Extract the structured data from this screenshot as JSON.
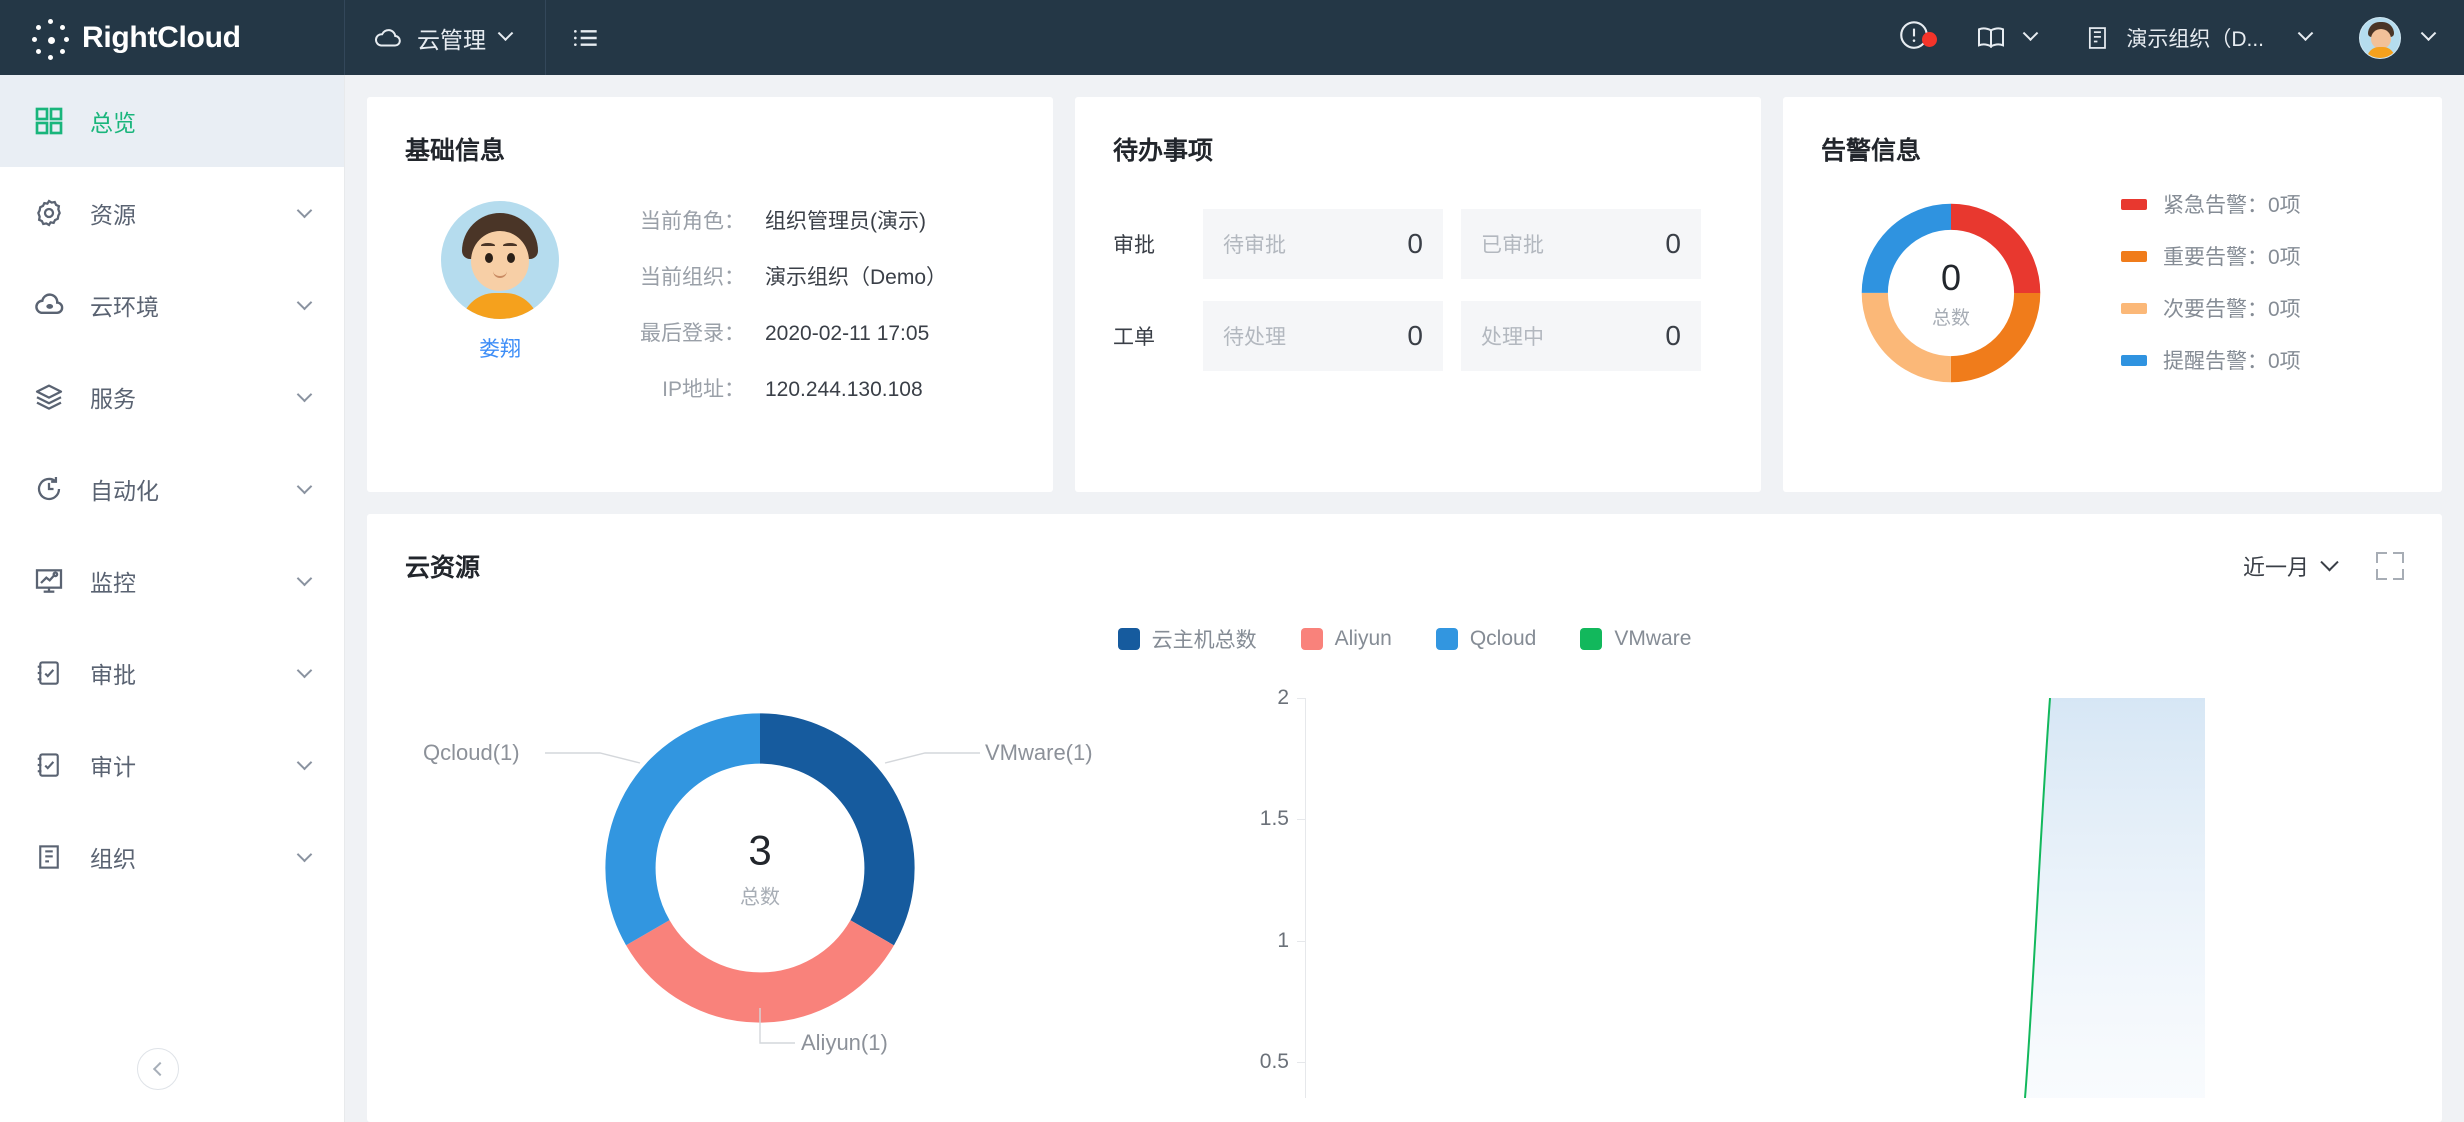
{
  "brand": {
    "name": "RightCloud",
    "logo_icon": "dots-logo-icon"
  },
  "header": {
    "cloud_mgmt": {
      "label": "云管理",
      "icon": "cloud-icon",
      "chevron": "chevron-down-icon"
    },
    "menu_icon": "list-menu-icon",
    "alert_icon": "alert-circle-icon",
    "book_icon": "book-icon",
    "book_chevron": "chevron-down-icon",
    "org": {
      "icon": "building-icon",
      "label": "演示组织（D...",
      "chevron": "chevron-down-icon"
    },
    "avatar": {
      "icon": "avatar-icon",
      "chevron": "chevron-down-icon"
    }
  },
  "sidebar": {
    "items": [
      {
        "label": "总览",
        "icon": "grid-icon",
        "active": true,
        "has_chevron": false
      },
      {
        "label": "资源",
        "icon": "gear-icon",
        "active": false,
        "has_chevron": true
      },
      {
        "label": "云环境",
        "icon": "cloud-icon",
        "active": false,
        "has_chevron": true
      },
      {
        "label": "服务",
        "icon": "layers-icon",
        "active": false,
        "has_chevron": true
      },
      {
        "label": "自动化",
        "icon": "clock-sync-icon",
        "active": false,
        "has_chevron": true
      },
      {
        "label": "监控",
        "icon": "monitor-icon",
        "active": false,
        "has_chevron": true
      },
      {
        "label": "审批",
        "icon": "approval-icon",
        "active": false,
        "has_chevron": true
      },
      {
        "label": "审计",
        "icon": "audit-icon",
        "active": false,
        "has_chevron": true
      },
      {
        "label": "组织",
        "icon": "org-icon",
        "active": false,
        "has_chevron": true
      }
    ],
    "collapse_icon": "chevron-left-icon"
  },
  "basic_info": {
    "title": "基础信息",
    "user_name": "娄翔",
    "rows": [
      {
        "label": "当前角色：",
        "value": "组织管理员(演示)"
      },
      {
        "label": "当前组织：",
        "value": "演示组织（Demo）"
      },
      {
        "label": "最后登录：",
        "value": "2020-02-11 17:05"
      },
      {
        "label": "IP地址：",
        "value": "120.244.130.108"
      }
    ]
  },
  "todo": {
    "title": "待办事项",
    "rows": [
      {
        "label": "审批",
        "boxes": [
          {
            "key": "待审批",
            "value": "0"
          },
          {
            "key": "已审批",
            "value": "0"
          }
        ]
      },
      {
        "label": "工单",
        "boxes": [
          {
            "key": "待处理",
            "value": "0"
          },
          {
            "key": "处理中",
            "value": "0"
          }
        ]
      }
    ]
  },
  "alerts": {
    "title": "告警信息",
    "total": "0",
    "total_caption": "总数",
    "legend": [
      {
        "label": "紧急告警：0项",
        "color": "#e8382f"
      },
      {
        "label": "重要告警：0项",
        "color": "#f07c1b"
      },
      {
        "label": "次要告警：0项",
        "color": "#fbb878"
      },
      {
        "label": "提醒告警：0项",
        "color": "#2f93e0"
      }
    ],
    "chart_data": {
      "type": "pie",
      "title": "告警信息",
      "labels": [
        "紧急告警",
        "重要告警",
        "次要告警",
        "提醒告警"
      ],
      "values": [
        1,
        1,
        1,
        1
      ],
      "displayed_counts": [
        0,
        0,
        0,
        0
      ],
      "colors": [
        "#e8382f",
        "#f07c1b",
        "#fbb878",
        "#2f93e0"
      ],
      "center_value": 0,
      "center_label": "总数",
      "legend_position": "right"
    }
  },
  "cloud_resources": {
    "title": "云资源",
    "period": "近一月",
    "period_chevron": "chevron-down-icon",
    "expand_icon": "fullscreen-expand-icon",
    "legend": [
      {
        "label": "云主机总数",
        "color": "#165b9e"
      },
      {
        "label": "Aliyun",
        "color": "#f9827b"
      },
      {
        "label": "Qcloud",
        "color": "#3296e0"
      },
      {
        "label": "VMware",
        "color": "#12b85c"
      }
    ],
    "pie": {
      "center_value": "3",
      "center_caption": "总数",
      "labels": [
        {
          "text": "VMware(1)",
          "color": "#165b9e"
        },
        {
          "text": "Aliyun(1)",
          "color": "#f9827b"
        },
        {
          "text": "Qcloud(1)",
          "color": "#3296e0"
        }
      ]
    },
    "line": {
      "y_ticks": [
        "2",
        "1.5",
        "1",
        "0.5"
      ]
    },
    "chart_data": [
      {
        "type": "pie",
        "title": "云资源",
        "labels": [
          "VMware(1)",
          "Aliyun(1)",
          "Qcloud(1)"
        ],
        "values": [
          1,
          1,
          1
        ],
        "colors": [
          "#165b9e",
          "#f9827b",
          "#3296e0"
        ],
        "center_value": 3,
        "center_label": "总数"
      },
      {
        "type": "line",
        "title": "云资源趋势",
        "series": [
          {
            "name": "云主机总数",
            "values": [
              0,
              0,
              0,
              2
            ]
          }
        ],
        "ylabel": "",
        "ytick_labels": [
          "0.5",
          "1",
          "1.5",
          "2"
        ],
        "ylim": [
          0,
          2
        ],
        "grid": false,
        "area_fill": true
      }
    ]
  }
}
